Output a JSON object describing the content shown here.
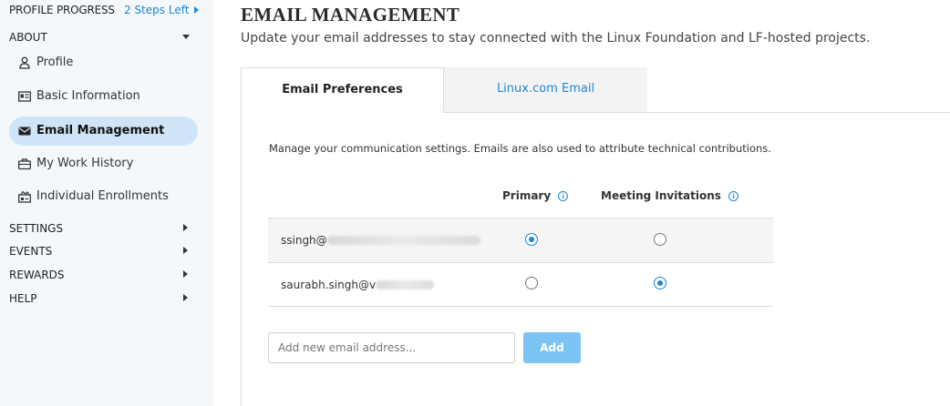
{
  "sidebar": {
    "progress": {
      "title": "PROFILE PROGRESS",
      "steps_left": "2 Steps Left"
    },
    "about": {
      "heading": "ABOUT",
      "items": [
        {
          "label": "Profile",
          "icon": "user-icon"
        },
        {
          "label": "Basic Information",
          "icon": "id-card-icon"
        },
        {
          "label": "Email Management",
          "icon": "envelope-icon",
          "active": true
        },
        {
          "label": "My Work History",
          "icon": "briefcase-icon"
        },
        {
          "label": "Individual Enrollments",
          "icon": "enrollment-icon"
        }
      ]
    },
    "sections": [
      {
        "label": "SETTINGS"
      },
      {
        "label": "EVENTS"
      },
      {
        "label": "REWARDS"
      },
      {
        "label": "HELP"
      }
    ]
  },
  "main": {
    "title": "EMAIL MANAGEMENT",
    "subtitle": "Update your email addresses to stay connected with the Linux Foundation and LF-hosted projects.",
    "tabs": [
      {
        "label": "Email Preferences",
        "active": true
      },
      {
        "label": "Linux.com Email",
        "active": false
      }
    ],
    "description": "Manage your communication settings. Emails are also used to attribute technical contributions.",
    "columns": {
      "primary": "Primary",
      "meeting": "Meeting Invitations"
    },
    "emails": [
      {
        "address_visible": "ssingh@",
        "primary": true,
        "meeting": false
      },
      {
        "address_visible": "saurabh.singh@v",
        "primary": false,
        "meeting": true
      }
    ],
    "add": {
      "placeholder": "Add new email address...",
      "button": "Add"
    }
  },
  "colors": {
    "accent": "#1f86d6",
    "active_nav": "#cfe5f7",
    "sidebar_bg": "#f4f8fb",
    "add_button": "#7cc4f4"
  }
}
